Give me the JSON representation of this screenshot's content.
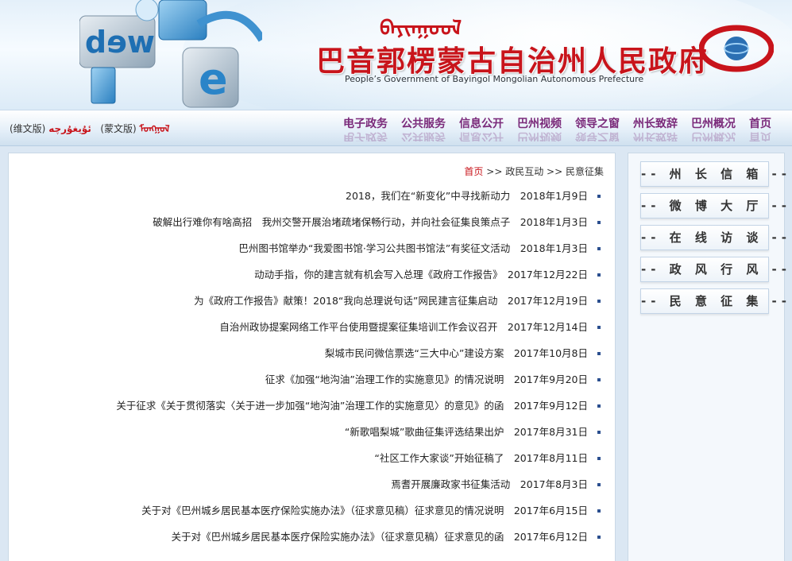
{
  "header": {
    "mongolian_script": "ᠪᠠᠶᠢᠨᠭᠤᠤᠯ",
    "title": "巴音郭楞蒙古自治州人民政府",
    "subtitle": "People’s Government of Bayingol Mongolian Autonomous Prefecture",
    "deco_word": "web"
  },
  "lang": {
    "mongol_label": "ᠮᠤᠩᠭᠤᠯ",
    "mongol_version": "(蒙文版)",
    "uyghur_label": "ئۇيغۇرچە",
    "uyghur_version": "(维文版)"
  },
  "nav": [
    "首页",
    "巴州概况",
    "州长致辞",
    "领导之窗",
    "巴州视频",
    "信息公开",
    "公共服务",
    "电子政务"
  ],
  "breadcrumb": {
    "home": "首页",
    "sep": ">>",
    "section": "政民互动",
    "current": "民意征集"
  },
  "news": [
    "2018，我们在“新变化”中寻找新动力　2018年1月9日",
    "破解出行难你有啥高招　我州交警开展治堵疏堵保畅行动，并向社会征集良策点子　2018年1月3日",
    "巴州图书馆举办“我爱图书馆·学习公共图书馆法”有奖征文活动　2018年1月3日",
    "动动手指，你的建言就有机会写入总理《政府工作报告》　2017年12月22日",
    "为《政府工作报告》献策！2018“我向总理说句话”网民建言征集启动　2017年12月19日",
    "自治州政协提案网络工作平台使用暨提案征集培训工作会议召开　2017年12月14日",
    "梨城市民问微信票选“三大中心”建设方案　2017年10月8日",
    "征求《加强“地沟油”治理工作的实施意见》的情况说明　2017年9月20日",
    "关于征求《关于贯彻落实〈关于进一步加强“地沟油”治理工作的实施意见〉的意见》的函　2017年9月12日",
    "“新歌唱梨城”歌曲征集评选结果出炉　2017年8月31日",
    "“社区工作大家谈”开始征稿了　2017年8月11日",
    "焉耆开展廉政家书征集活动　2017年8月3日",
    "关于对《巴州城乡居民基本医疗保险实施办法》（征求意见稿）征求意见的情况说明　2017年6月15日",
    "关于对《巴州城乡居民基本医疗保险实施办法》（征求意见稿）征求意见的函　2017年6月12日"
  ],
  "sidebar": [
    "-- 州 长 信 箱 --",
    "-- 微 博 大 厅 --",
    "-- 在 线 访 谈 --",
    "-- 政 风 行 风 --",
    "-- 民 意 征 集 --"
  ],
  "colors": {
    "brand_red": "#c8141b",
    "nav_text": "#7a2a7a",
    "bullet": "#2b4f8f"
  }
}
